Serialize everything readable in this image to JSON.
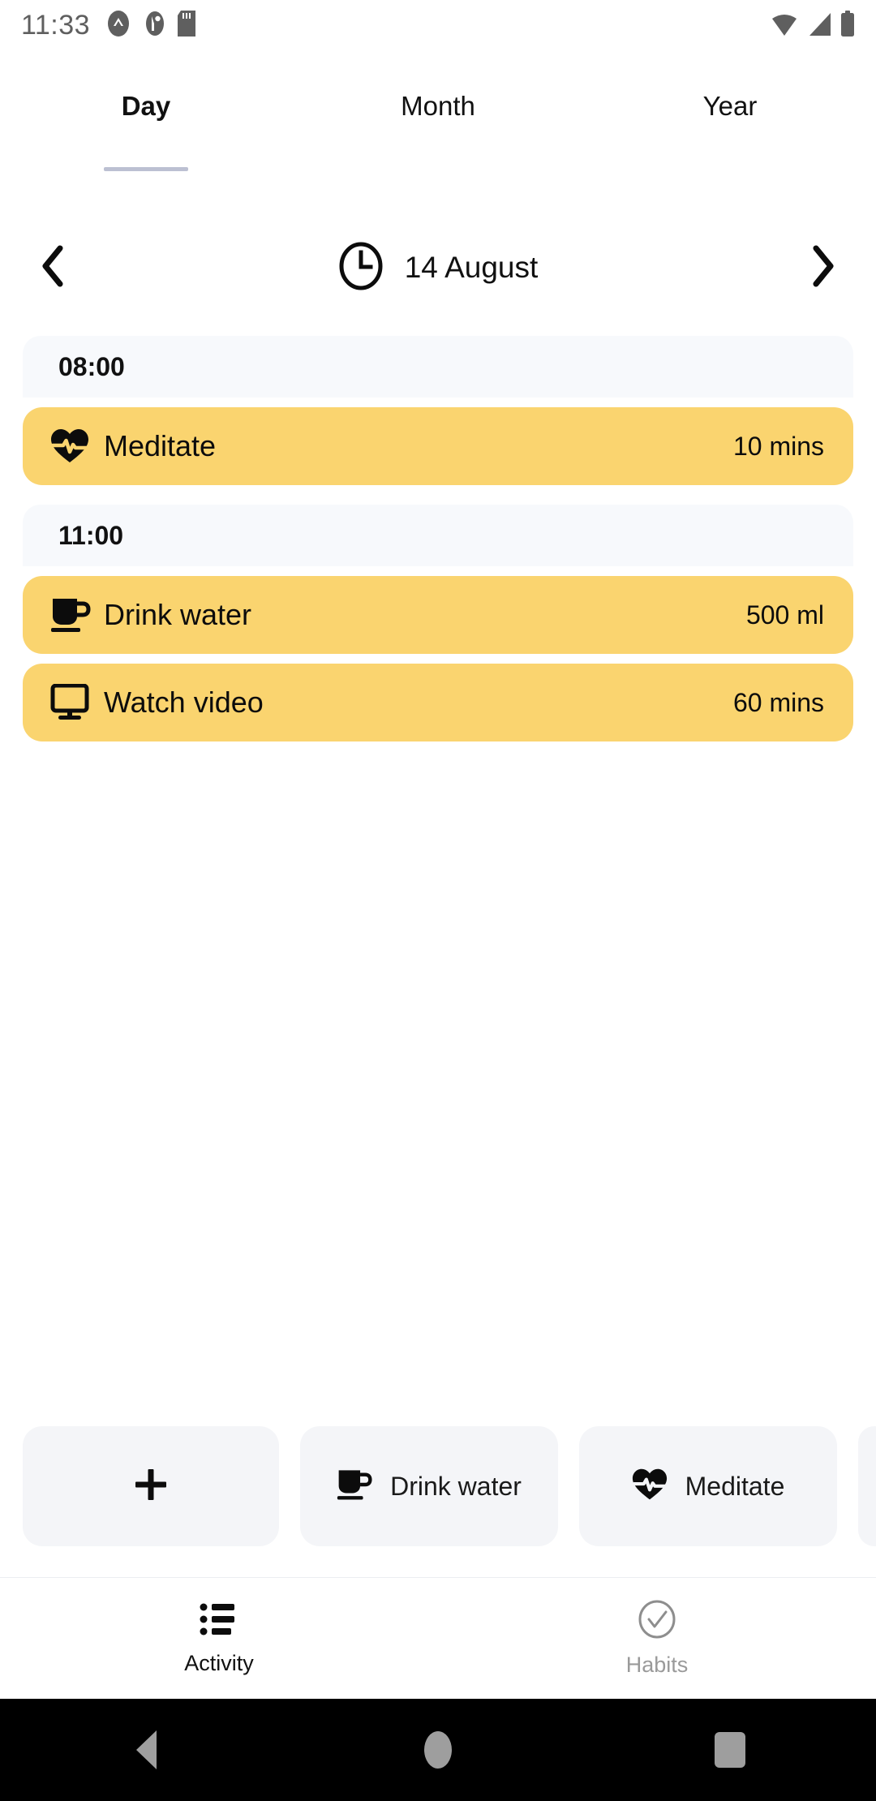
{
  "status_bar": {
    "time": "11:33",
    "left_icons": [
      "notification-circle-a-icon",
      "notification-circle-b-icon",
      "sd-card-icon"
    ],
    "right_icons": [
      "wifi-icon",
      "cellular-signal-icon",
      "battery-icon"
    ]
  },
  "tabs": {
    "items": [
      {
        "label": "Day",
        "active": true
      },
      {
        "label": "Month",
        "active": false
      },
      {
        "label": "Year",
        "active": false
      }
    ],
    "underline_color": "#bcc0d2"
  },
  "date_nav": {
    "prev_icon": "chevron-left-icon",
    "clock_icon": "clock-icon",
    "date": "14 August",
    "next_icon": "chevron-right-icon"
  },
  "schedule": {
    "card_color": "#fad46f",
    "time_header_color": "#f7f9fc",
    "groups": [
      {
        "time": "08:00",
        "habits": [
          {
            "icon": "heart-pulse-icon",
            "name": "Meditate",
            "value": "10 mins"
          }
        ]
      },
      {
        "time": "11:00",
        "habits": [
          {
            "icon": "mug-icon",
            "name": "Drink water",
            "value": "500 ml"
          },
          {
            "icon": "monitor-icon",
            "name": "Watch video",
            "value": "60 mins"
          }
        ]
      }
    ]
  },
  "quick_actions": {
    "chips": [
      {
        "icon": "plus-icon",
        "label": ""
      },
      {
        "icon": "mug-icon",
        "label": "Drink water"
      },
      {
        "icon": "heart-pulse-icon",
        "label": "Meditate"
      }
    ],
    "chip_color": "#f4f5f8"
  },
  "bottom_nav": {
    "items": [
      {
        "icon": "list-icon",
        "label": "Activity",
        "active": true
      },
      {
        "icon": "check-circle-icon",
        "label": "Habits",
        "active": false
      }
    ]
  },
  "system_nav": {
    "back_icon": "triangle-back-icon",
    "home_icon": "circle-home-icon",
    "recents_icon": "square-recents-icon"
  }
}
